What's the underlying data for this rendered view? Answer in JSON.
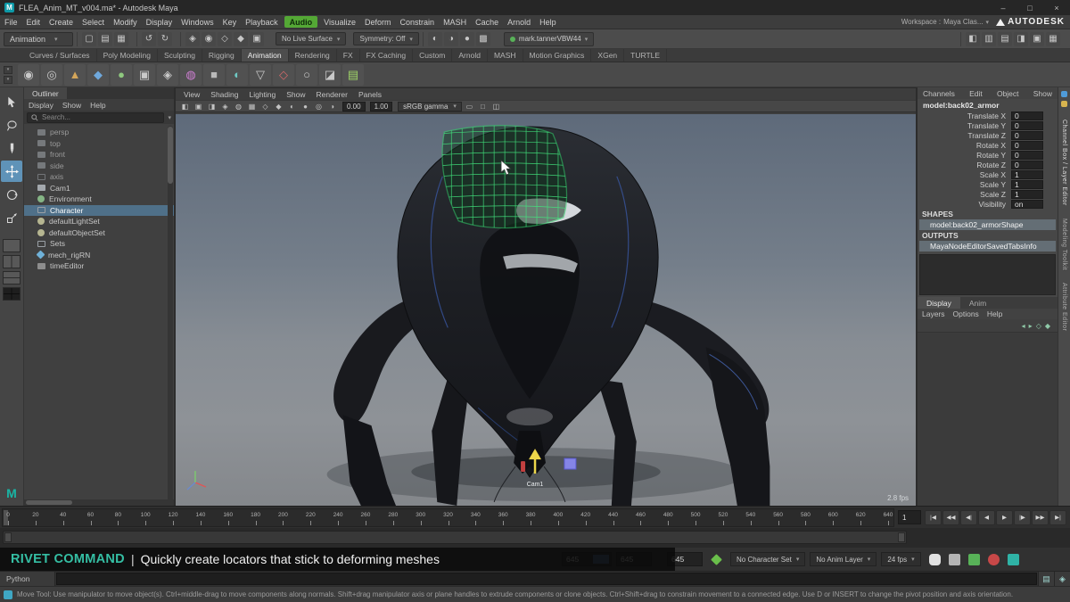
{
  "titlebar": {
    "title": "FLEA_Anim_MT_v004.ma* - Autodesk Maya",
    "logo_letter": "M",
    "minimize_glyph": "–",
    "maximize_glyph": "□",
    "close_glyph": "×"
  },
  "brand": {
    "name": "AUTODESK"
  },
  "menubar": {
    "items": [
      {
        "label": "File"
      },
      {
        "label": "Edit"
      },
      {
        "label": "Create"
      },
      {
        "label": "Select"
      },
      {
        "label": "Modify"
      },
      {
        "label": "Display"
      },
      {
        "label": "Windows"
      },
      {
        "label": "Key"
      },
      {
        "label": "Playback"
      },
      {
        "label": "Audio",
        "highlight": true
      },
      {
        "label": "Visualize"
      },
      {
        "label": "Deform"
      },
      {
        "label": "Constrain"
      },
      {
        "label": "MASH"
      },
      {
        "label": "Cache"
      },
      {
        "label": "Arnold"
      },
      {
        "label": "Help"
      }
    ],
    "workspace_label": "Workspace :",
    "workspace_value": "Maya Clas..."
  },
  "statusbar": {
    "mode": "Animation",
    "left_groups": [
      [
        [
          "new-scene-icon",
          "▢"
        ],
        [
          "open-scene-icon",
          "▤"
        ],
        [
          "save-scene-icon",
          "▦"
        ]
      ],
      [
        [
          "undo-icon",
          "↺"
        ],
        [
          "redo-icon",
          "↻"
        ]
      ],
      [
        [
          "snap-grid-icon",
          "◈"
        ],
        [
          "snap-curve-icon",
          "◉"
        ],
        [
          "snap-point-icon",
          "◇"
        ],
        [
          "snap-view-plane-icon",
          "◆"
        ],
        [
          "make-live-icon",
          "▣"
        ]
      ]
    ],
    "no_live_surface": "No Live Surface",
    "symmetry": "Symmetry: Off",
    "mid_groups": [
      [
        [
          "construction-history-icon",
          "◐"
        ],
        [
          "render-icon",
          "◑"
        ],
        [
          "ipr-render-icon",
          "●"
        ],
        [
          "render-settings-icon",
          "▩"
        ]
      ]
    ],
    "account": "mark.tannerVBW44",
    "right_groups": [
      [
        [
          "sidebar-toggle-icon",
          "◧"
        ],
        [
          "attribute-editor-toggle-icon",
          "▥"
        ],
        [
          "tool-settings-toggle-icon",
          "▤"
        ],
        [
          "channel-box-toggle-icon",
          "◨"
        ],
        [
          "modeling-toolkit-toggle-icon",
          "▣"
        ],
        [
          "grid-icon",
          "▦"
        ]
      ]
    ]
  },
  "shelf": {
    "tabs": [
      "Curves / Surfaces",
      "Poly Modeling",
      "Sculpting",
      "Rigging",
      "Animation",
      "Rendering",
      "FX",
      "FX Caching",
      "Custom",
      "Arnold",
      "MASH",
      "Motion Graphics",
      "XGen",
      "TURTLE"
    ],
    "active_tab": "Animation",
    "icons": [
      [
        "shelf-icon-1",
        "◉",
        "#c9c9c9"
      ],
      [
        "shelf-icon-2",
        "◎",
        "#c9c9c9"
      ],
      [
        "shelf-icon-3",
        "▲",
        "#d4a65a"
      ],
      [
        "shelf-icon-4",
        "◆",
        "#6fa8dc"
      ],
      [
        "shelf-icon-5",
        "●",
        "#8fc97f"
      ],
      [
        "shelf-icon-6",
        "▣",
        "#c9c9c9"
      ],
      [
        "shelf-icon-7",
        "◈",
        "#c9c9c9"
      ],
      [
        "shelf-icon-8",
        "◍",
        "#cf7fd4"
      ],
      [
        "shelf-icon-9",
        "■",
        "#b9b9b9"
      ],
      [
        "shelf-icon-10",
        "◐",
        "#6fc9c4"
      ],
      [
        "shelf-icon-11",
        "▽",
        "#c9c9c9"
      ],
      [
        "shelf-icon-12",
        "◇",
        "#d46a6a"
      ],
      [
        "shelf-icon-13",
        "○",
        "#c9c9c9"
      ],
      [
        "shelf-icon-14",
        "◪",
        "#c9c9c9"
      ],
      [
        "shelf-icon-15",
        "▤",
        "#9fd468"
      ]
    ]
  },
  "toolbox": {
    "tools": [
      {
        "name": "select-tool"
      },
      {
        "name": "lasso-tool"
      },
      {
        "name": "paint-select-tool"
      },
      {
        "name": "move-tool",
        "active": true
      },
      {
        "name": "rotate-tool"
      },
      {
        "name": "scale-tool"
      }
    ]
  },
  "outliner": {
    "tab": "Outliner",
    "menus": [
      "Display",
      "Show",
      "Help"
    ],
    "search_placeholder": "Search...",
    "items": [
      {
        "label": "persp",
        "type": "camera",
        "dim": true
      },
      {
        "label": "top",
        "type": "camera",
        "dim": true
      },
      {
        "label": "front",
        "type": "camera",
        "dim": true
      },
      {
        "label": "side",
        "type": "camera",
        "dim": true
      },
      {
        "label": "axis",
        "type": "transform",
        "dim": true
      },
      {
        "label": "Cam1",
        "type": "camera"
      },
      {
        "label": "Environment",
        "type": "env"
      },
      {
        "label": "Character",
        "type": "group",
        "selected": true
      },
      {
        "label": "defaultLightSet",
        "type": "set"
      },
      {
        "label": "defaultObjectSet",
        "type": "set"
      },
      {
        "label": "Sets",
        "type": "group"
      },
      {
        "label": "mech_rigRN",
        "type": "ref"
      },
      {
        "label": "timeEditor",
        "type": "node"
      }
    ]
  },
  "viewport": {
    "menus": [
      "View",
      "Shading",
      "Lighting",
      "Show",
      "Renderer",
      "Panels"
    ],
    "icons_a": [
      [
        "select-by-hierarchy-icon",
        "◧"
      ],
      [
        "select-by-object-icon",
        "▣"
      ],
      [
        "select-by-component-icon",
        "◨"
      ],
      [
        "snap-magnet-icon",
        "◈"
      ],
      [
        "camera-lock-icon",
        "◍"
      ],
      [
        "grid-toggle-icon",
        "▦"
      ],
      [
        "wireframe-icon",
        "◇"
      ],
      [
        "shaded-icon",
        "◆"
      ],
      [
        "textured-icon",
        "◐"
      ],
      [
        "lighting-icon",
        "●"
      ],
      [
        "xray-icon",
        "◎"
      ],
      [
        "isolate-select-icon",
        "◑"
      ]
    ],
    "exposure": "0.00",
    "gamma": "1.00",
    "view_transform": "sRGB gamma",
    "icons_b": [
      [
        "resolution-gate-icon",
        "▭"
      ],
      [
        "film-gate-icon",
        "□"
      ],
      [
        "safe-area-icon",
        "◫"
      ]
    ],
    "camera_label": "Cam1",
    "fps_display": "2.8 fps"
  },
  "channelbox": {
    "menus": [
      "Channels",
      "Edit",
      "Object",
      "Show"
    ],
    "node_name": "model:back02_armor",
    "attributes": [
      {
        "name": "Translate X",
        "value": "0"
      },
      {
        "name": "Translate Y",
        "value": "0"
      },
      {
        "name": "Translate Z",
        "value": "0"
      },
      {
        "name": "Rotate X",
        "value": "0"
      },
      {
        "name": "Rotate Y",
        "value": "0"
      },
      {
        "name": "Rotate Z",
        "value": "0"
      },
      {
        "name": "Scale X",
        "value": "1"
      },
      {
        "name": "Scale Y",
        "value": "1"
      },
      {
        "name": "Scale Z",
        "value": "1"
      },
      {
        "name": "Visibility",
        "value": "on"
      }
    ],
    "shapes_header": "SHAPES",
    "shape_name": "model:back02_armorShape",
    "outputs_header": "OUTPUTS",
    "output_name": "MayaNodeEditorSavedTabsInfo",
    "tabs": [
      "Display",
      "Anim"
    ],
    "active_tab": "Display",
    "submenus": [
      "Layers",
      "Options",
      "Help"
    ],
    "layer_icons": [
      [
        "move-layer-up-icon",
        "◂"
      ],
      [
        "move-layer-down-icon",
        "▸"
      ],
      [
        "empty-layer-icon",
        "◇"
      ],
      [
        "new-layer-icon",
        "◆"
      ]
    ]
  },
  "right_strip": {
    "labels": [
      "Channel Box / Layer Editor",
      "Modeling Toolkit",
      "Attribute Editor"
    ]
  },
  "timeline": {
    "ticks": [
      0,
      20,
      40,
      60,
      80,
      100,
      120,
      140,
      160,
      180,
      200,
      220,
      240,
      260,
      280,
      300,
      320,
      340,
      360,
      380,
      400,
      420,
      440,
      460,
      480,
      500,
      520,
      540,
      560,
      580,
      600,
      620,
      640
    ],
    "current_frame": "1",
    "playback": [
      [
        "go-to-start-button",
        "|◀"
      ],
      [
        "prev-key-button",
        "◀◀"
      ],
      [
        "prev-frame-button",
        "◀|"
      ],
      [
        "play-backwards-button",
        "◀"
      ],
      [
        "play-forwards-button",
        "▶"
      ],
      [
        "next-frame-button",
        "|▶"
      ],
      [
        "next-key-button",
        "▶▶"
      ],
      [
        "go-to-end-button",
        "▶|"
      ]
    ]
  },
  "range": {
    "animation_start": "645",
    "playback_start": "645",
    "playback_end": "645",
    "character_set": "No Character Set",
    "anim_layer": "No Anim Layer",
    "fps": "24 fps"
  },
  "caption": {
    "keyword": "RIVET COMMAND",
    "separator": "|",
    "text": "Quickly create locators that stick to deforming meshes"
  },
  "commandline": {
    "label": "Python"
  },
  "helpline": {
    "text": "Move Tool: Use manipulator to move object(s). Ctrl+middle-drag to move components along normals. Shift+drag manipulator axis or plane handles to extrude components or clone objects. Ctrl+Shift+drag to constrain movement to a connected edge. Use D or INSERT to change the pivot position and axis orientation."
  }
}
